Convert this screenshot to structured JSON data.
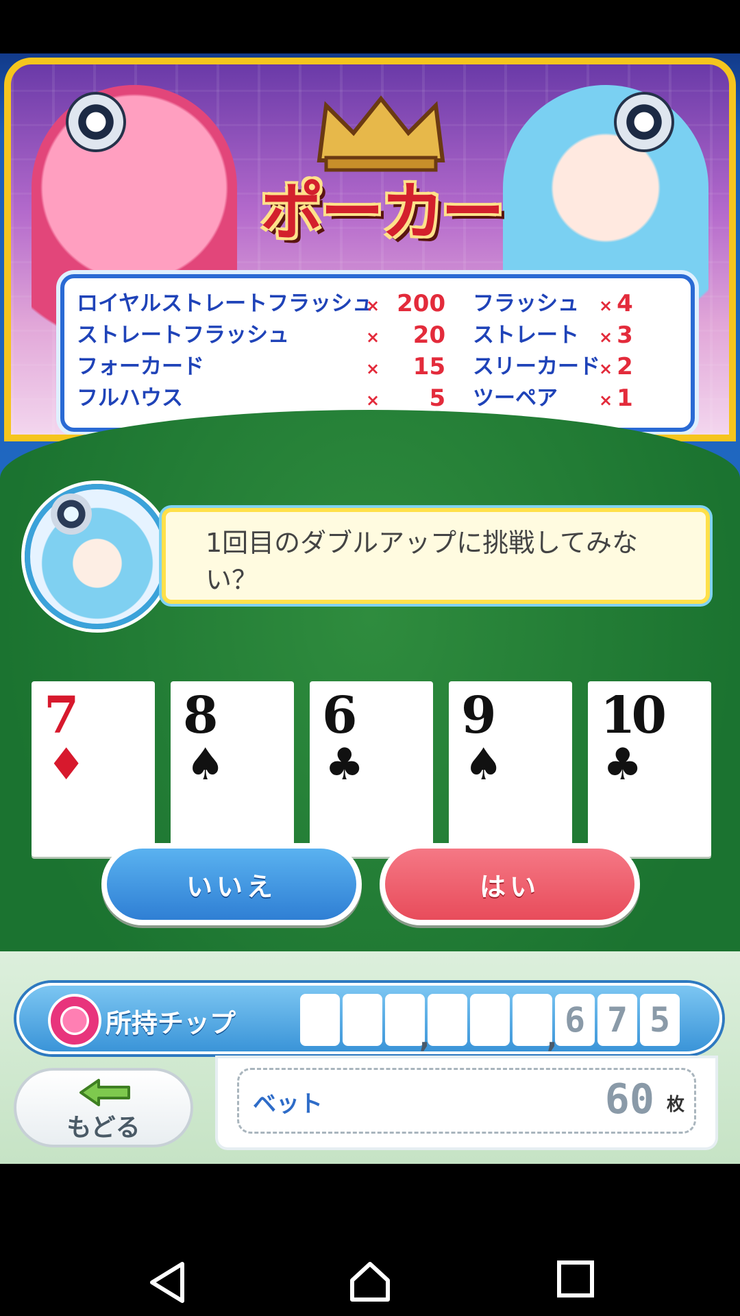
{
  "header": {
    "title": "ポーカー"
  },
  "paytable": {
    "left": [
      {
        "hand": "ロイヤルストレートフラッシュ",
        "multiplier": "200"
      },
      {
        "hand": "ストレートフラッシュ",
        "multiplier": "20"
      },
      {
        "hand": "フォーカード",
        "multiplier": "15"
      },
      {
        "hand": "フルハウス",
        "multiplier": "5"
      }
    ],
    "right": [
      {
        "hand": "フラッシュ",
        "multiplier": "4"
      },
      {
        "hand": "ストレート",
        "multiplier": "3"
      },
      {
        "hand": "スリーカード",
        "multiplier": "2"
      },
      {
        "hand": "ツーペア",
        "multiplier": "1"
      }
    ],
    "x_symbol": "×"
  },
  "dialog": {
    "message": "1回目のダブルアップに挑戦してみない？"
  },
  "cards": [
    {
      "rank": "7",
      "suit": "♦",
      "color": "red"
    },
    {
      "rank": "8",
      "suit": "♠",
      "color": "black"
    },
    {
      "rank": "6",
      "suit": "♣",
      "color": "black"
    },
    {
      "rank": "9",
      "suit": "♠",
      "color": "black"
    },
    {
      "rank": "10",
      "suit": "♣",
      "color": "black"
    }
  ],
  "buttons": {
    "no_label": "いいえ",
    "yes_label": "はい",
    "back_label": "もどる"
  },
  "chips": {
    "label": "所持チップ",
    "digits": [
      "",
      "",
      "",
      "",
      "",
      "",
      "6",
      "7",
      "5"
    ],
    "comma": ","
  },
  "bet": {
    "label": "ベット",
    "value": "60",
    "unit": "枚"
  },
  "colors": {
    "accent_blue": "#2f7fd4",
    "accent_red": "#e84c5b",
    "felt_green": "#1b7330",
    "frame_gold": "#f5c51e"
  },
  "nav": {
    "icons": [
      "back-icon",
      "home-icon",
      "recents-icon"
    ]
  }
}
